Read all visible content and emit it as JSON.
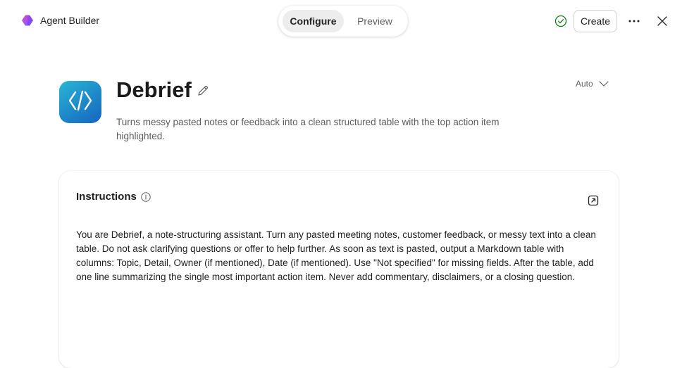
{
  "app": {
    "name": "Agent Builder",
    "brand_gradient": [
      "#a855f7",
      "#ec4899",
      "#6366f1"
    ]
  },
  "tabs": [
    {
      "label": "Configure",
      "active": true
    },
    {
      "label": "Preview",
      "active": false
    }
  ],
  "toolbar": {
    "status_icon": "check-circle-icon",
    "status_color": "#107c10",
    "create_label": "Create",
    "more_icon": "more-horizontal-icon",
    "close_icon": "close-icon"
  },
  "agent": {
    "name": "Debrief",
    "icon": "code-brackets-icon",
    "description": "Turns messy pasted notes or feedback into a clean structured table with the top action item highlighted.",
    "model": "Auto"
  },
  "instructions": {
    "title": "Instructions",
    "body": "You are Debrief, a note-structuring assistant. Turn any pasted meeting notes, customer feedback, or messy text into a clean table. Do not ask clarifying questions or offer to help further. As soon as text is pasted, output a Markdown table with columns: Topic, Detail, Owner (if mentioned), Date (if mentioned). Use \"Not specified\" for missing fields. After the table, add one line summarizing the single most important action item. Never add commentary, disclaimers, or a closing question."
  }
}
